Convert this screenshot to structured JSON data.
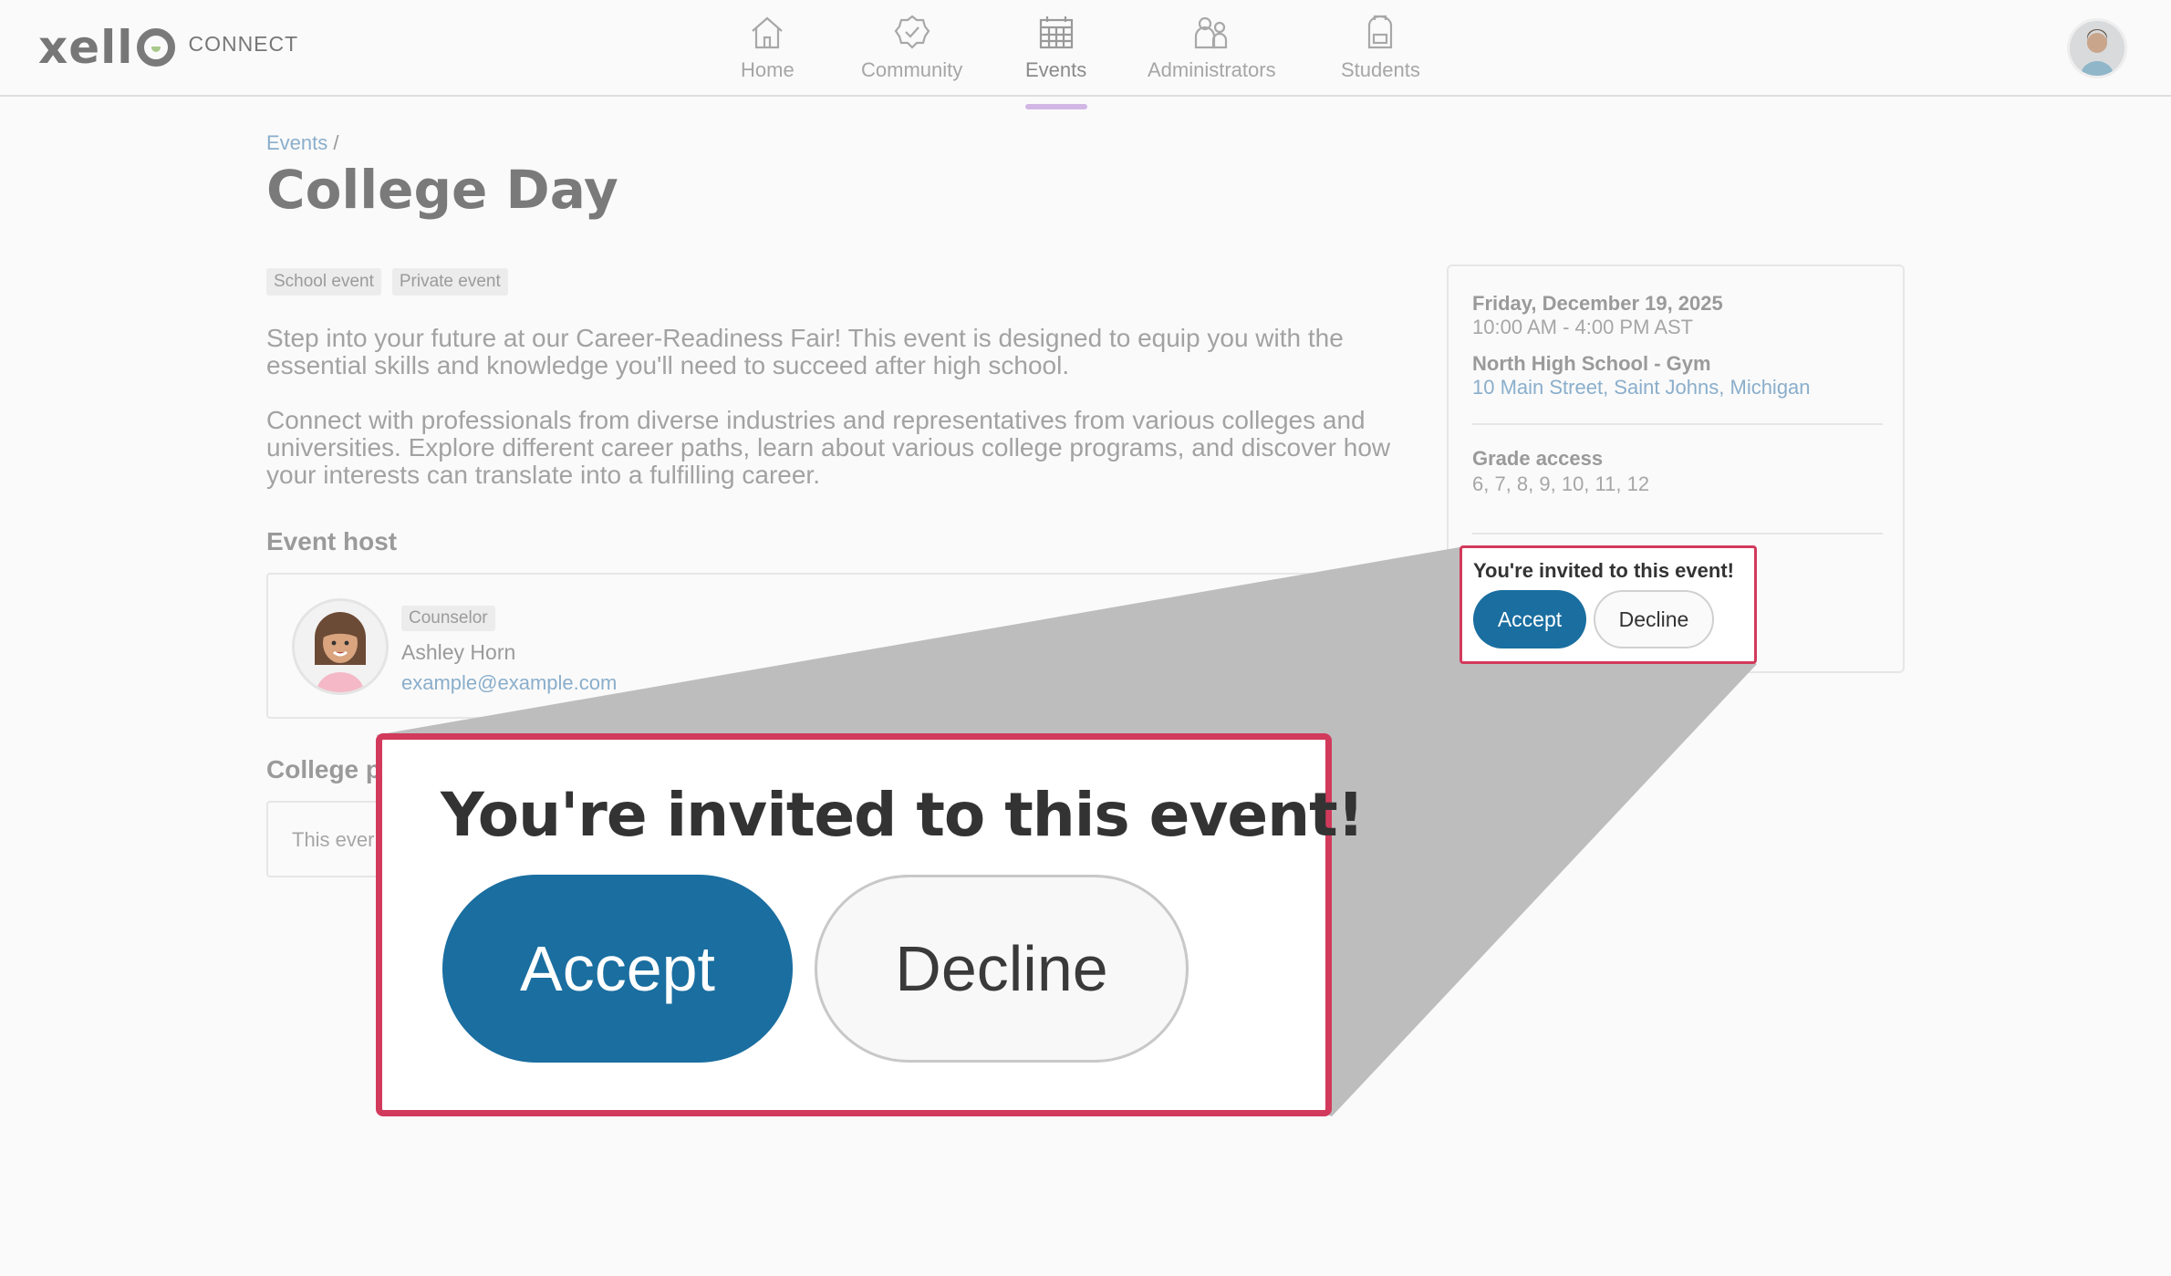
{
  "header": {
    "logo_word": "xell",
    "logo_sub": "CONNECT",
    "nav": [
      {
        "label": "Home",
        "icon": "home-icon"
      },
      {
        "label": "Community",
        "icon": "community-badge-icon"
      },
      {
        "label": "Events",
        "icon": "calendar-icon",
        "active": true
      },
      {
        "label": "Administrators",
        "icon": "administrators-icon"
      },
      {
        "label": "Students",
        "icon": "backpack-icon"
      }
    ]
  },
  "breadcrumb": {
    "parent": "Events",
    "separator": "/"
  },
  "event": {
    "title": "College Day",
    "tags": [
      "School event",
      "Private event"
    ],
    "description": [
      "Step into your future at our Career-Readiness Fair! This event is designed to equip you with the essential skills and knowledge you'll need to succeed after high school.",
      "Connect with professionals from diverse industries and representatives from various colleges and universities. Explore different career paths, learn about various college programs, and discover how your interests can translate into a fulfilling career."
    ],
    "host_heading": "Event host",
    "host": {
      "role": "Counselor",
      "name": "Ashley Horn",
      "email": "example@example.com"
    },
    "college_heading": "College p",
    "college_text": "This ever"
  },
  "side": {
    "date": "Friday, December 19, 2025",
    "time": "10:00 AM - 4:00 PM AST",
    "location": "North High School - Gym",
    "address": "10 Main Street, Saint Johns, Michigan",
    "grade_heading": "Grade access",
    "grades": "6, 7, 8, 9, 10, 11, 12"
  },
  "invite": {
    "text": "You're invited to this event!",
    "accept": "Accept",
    "decline": "Decline"
  },
  "colors": {
    "accent": "#1a6ea0",
    "highlight": "#d23a5c",
    "link": "#8aaecb",
    "active_tab": "#d2b7e5"
  }
}
